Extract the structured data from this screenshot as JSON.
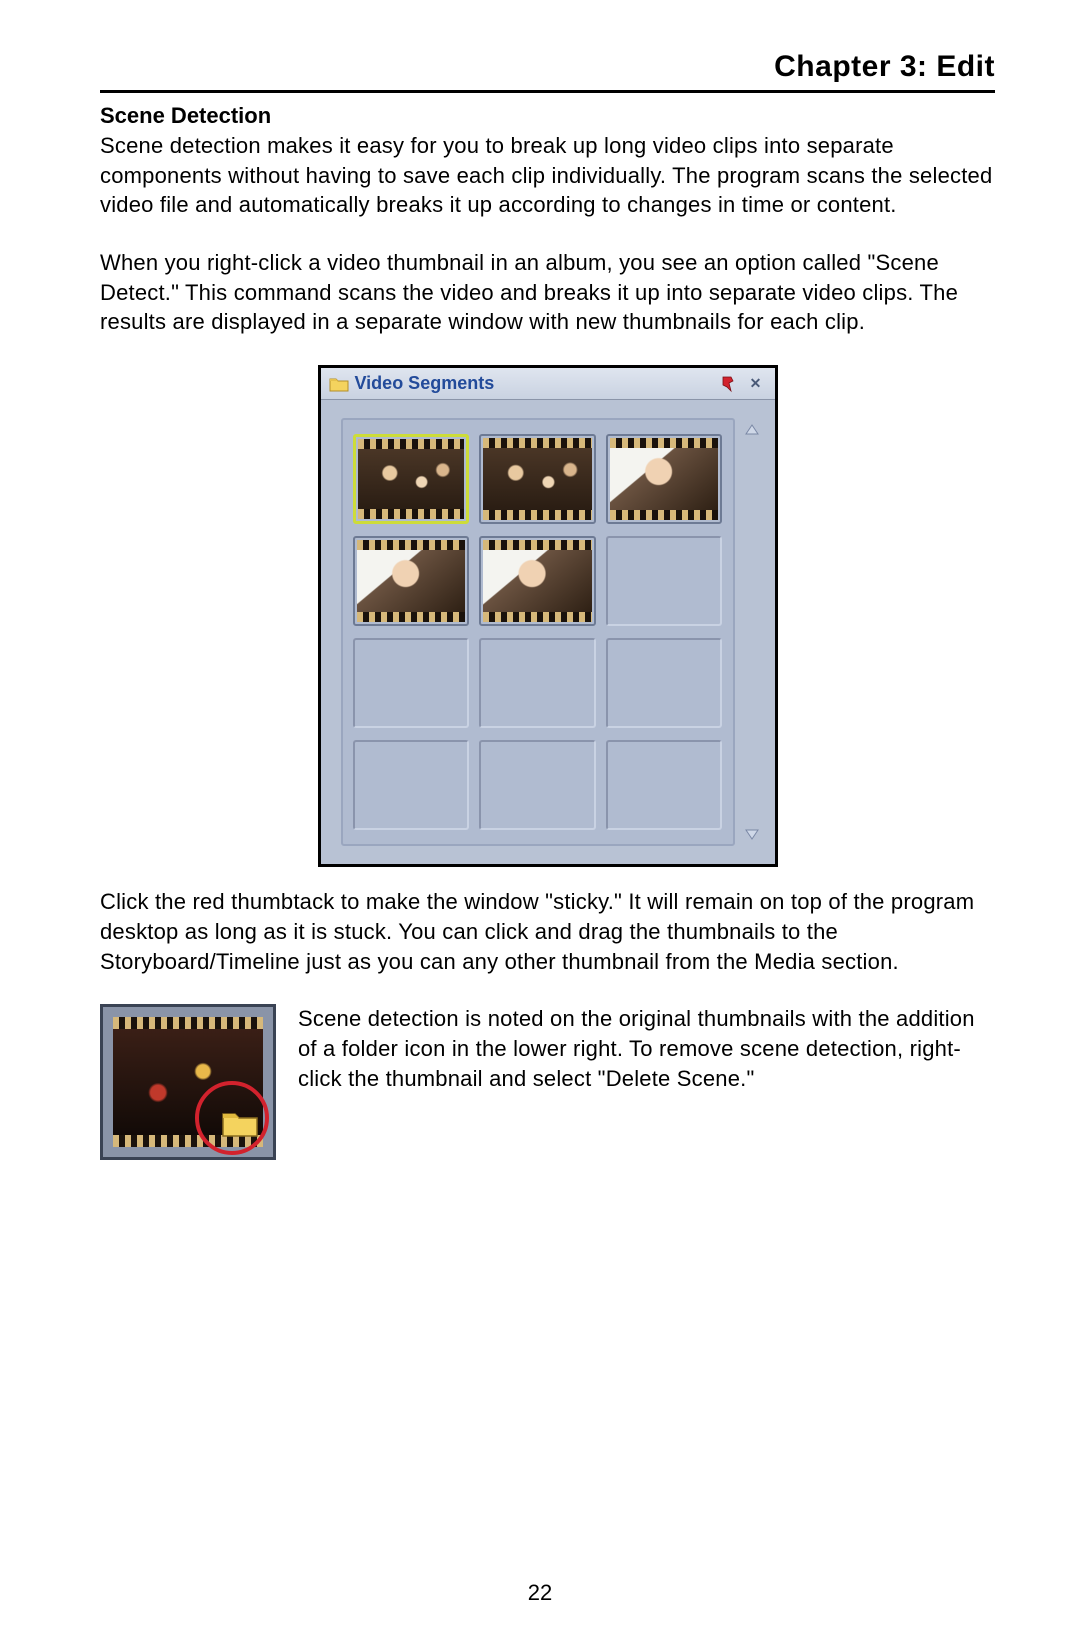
{
  "chapter_title": "Chapter 3:  Edit",
  "section_heading": "Scene Detection",
  "para1": "Scene detection makes it easy for you to break up long video clips into separate components without having to save each clip individually. The program scans the selected video file and automatically breaks it up according to changes in time or content.",
  "para2": "When you right-click a video thumbnail in an album, you see an option called \"Scene Detect.\" This command scans the video and breaks it up into separate video clips. The results are displayed in a separate window with new thumbnails for each clip.",
  "window": {
    "title": "Video Segments",
    "close_glyph": "✕"
  },
  "para3": "Click the red thumbtack to make the window \"sticky.\" It will remain on top of the program desktop as long as it is stuck. You can click and drag the thumbnails to the Storyboard/Timeline just as you can any other thumbnail from the Media section.",
  "para4": "Scene detection is noted on the original thumbnails with the addition of a folder icon in the lower right. To remove scene detection, right-click the thumbnail and select \"Delete Scene.\"",
  "page_number": "22"
}
